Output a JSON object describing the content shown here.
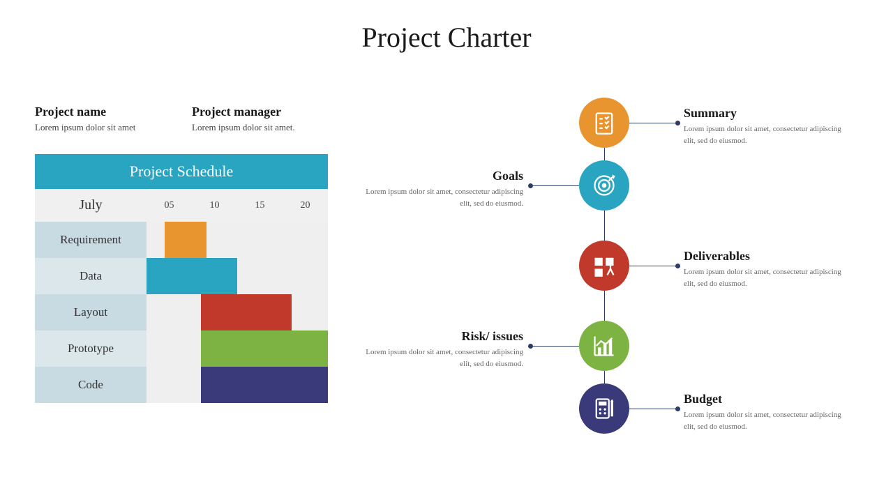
{
  "title": "Project Charter",
  "meta": {
    "project_name_label": "Project name",
    "project_name_value": "Lorem ipsum dolor sit amet",
    "project_manager_label": "Project manager",
    "project_manager_value": "Lorem ipsum dolor sit amet."
  },
  "schedule": {
    "header": "Project Schedule",
    "month": "July",
    "dates": [
      "05",
      "10",
      "15",
      "20"
    ],
    "tasks": [
      {
        "name": "Requirement",
        "start_pct": 10,
        "width_pct": 23,
        "color": "#e8942f"
      },
      {
        "name": "Data",
        "start_pct": 0,
        "width_pct": 50,
        "color": "#2aa5c1"
      },
      {
        "name": "Layout",
        "start_pct": 30,
        "width_pct": 50,
        "color": "#c0392b"
      },
      {
        "name": "Prototype",
        "start_pct": 30,
        "width_pct": 70,
        "color": "#7cb342"
      },
      {
        "name": "Code",
        "start_pct": 30,
        "width_pct": 70,
        "color": "#3a3a7a"
      }
    ]
  },
  "items": [
    {
      "title": "Summary",
      "desc": "Lorem ipsum dolor sit amet, consectetur adipiscing elit, sed do eiusmod.",
      "color": "#e8942f",
      "icon": "checklist",
      "side": "right"
    },
    {
      "title": "Goals",
      "desc": "Lorem ipsum dolor sit amet, consectetur adipiscing elit, sed do eiusmod.",
      "color": "#2aa5c1",
      "icon": "target",
      "side": "left"
    },
    {
      "title": "Deliverables",
      "desc": "Lorem ipsum dolor sit amet, consectetur adipiscing elit, sed do eiusmod.",
      "color": "#c0392b",
      "icon": "boxes",
      "side": "right"
    },
    {
      "title": "Risk/ issues",
      "desc": "Lorem ipsum dolor sit amet, consectetur adipiscing elit, sed do eiusmod.",
      "color": "#7cb342",
      "icon": "chart",
      "side": "left"
    },
    {
      "title": "Budget",
      "desc": "Lorem ipsum dolor sit amet, consectetur adipiscing elit, sed do eiusmod.",
      "color": "#3a3a7a",
      "icon": "calculator",
      "side": "right"
    }
  ],
  "chart_data": {
    "type": "gantt",
    "title": "Project Schedule",
    "month": "July",
    "x_ticks": [
      5,
      10,
      15,
      20
    ],
    "tasks": [
      {
        "name": "Requirement",
        "start": 3,
        "end": 7,
        "color": "#e8942f"
      },
      {
        "name": "Data",
        "start": 1,
        "end": 10,
        "color": "#2aa5c1"
      },
      {
        "name": "Layout",
        "start": 7,
        "end": 17,
        "color": "#c0392b"
      },
      {
        "name": "Prototype",
        "start": 7,
        "end": 22,
        "color": "#7cb342"
      },
      {
        "name": "Code",
        "start": 7,
        "end": 22,
        "color": "#3a3a7a"
      }
    ]
  }
}
